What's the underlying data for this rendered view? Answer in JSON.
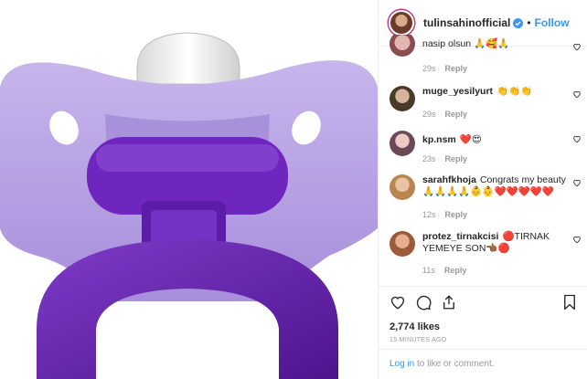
{
  "post": {
    "image_alt": "purple pacifier"
  },
  "header": {
    "username": "tulinsahinofficial",
    "separator": "•",
    "follow_label": "Follow"
  },
  "comments": [
    {
      "username": "",
      "text": "nasip olsun 🙏🥰🙏",
      "time": "29s",
      "reply": "Reply"
    },
    {
      "username": "muge_yesilyurt",
      "text": "👏👏👏",
      "time": "29s",
      "reply": "Reply"
    },
    {
      "username": "kp.nsm",
      "text": "❤️😍",
      "time": "23s",
      "reply": "Reply"
    },
    {
      "username": "sarahfkhoja",
      "text": "Congrats my beauty 🙏🙏🙏🙏👶👶❤️❤️❤️❤️❤️",
      "time": "12s",
      "reply": "Reply"
    },
    {
      "username": "protez_tirnakcisi",
      "text": "🔴TIRNAK YEMEYE SON👈🏾🔴",
      "time": "11s",
      "reply": "Reply"
    }
  ],
  "actions": {
    "likes": "2,774 likes",
    "time_ago": "15 MINUTES AGO",
    "login_link": "Log in",
    "login_rest": " to like or comment."
  },
  "colors": {
    "link_blue": "#3897f0",
    "pacifier_shield": "#b9a3e3",
    "pacifier_ring": "#6a24b8"
  },
  "icons": [
    "heart-icon",
    "comment-icon",
    "share-icon",
    "bookmark-icon",
    "verified-badge-icon"
  ]
}
